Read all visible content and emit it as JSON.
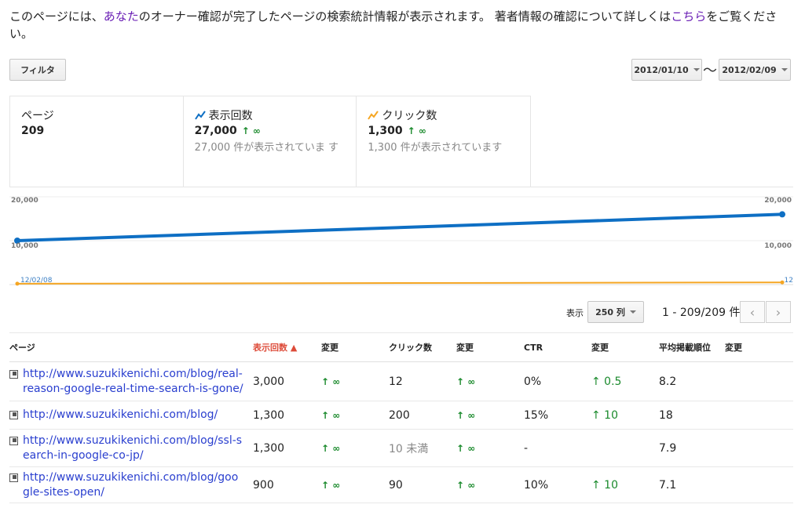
{
  "intro": {
    "text1": "このページには、",
    "link1": "あなた",
    "text2": "のオーナー確認が完了したページの検索統計情報が表示されます。 著者情報の確認について詳しくは",
    "link2": "こちら",
    "text3": "をご覧ください。"
  },
  "filter_label": "フィルタ",
  "date_start": "2012/01/10",
  "date_sep": "〜",
  "date_end": "2012/02/09",
  "summary": [
    {
      "label": "ページ",
      "value": "209",
      "change": "",
      "sub": ""
    },
    {
      "label": "表示回数",
      "value": "27,000",
      "change": "↑ ∞",
      "sub": "27,000 件が表示されていま す"
    },
    {
      "label": "クリック数",
      "value": "1,300",
      "change": "↑ ∞",
      "sub": "1,300 件が表示されています"
    }
  ],
  "colors": {
    "impressions": "#0e6fc4",
    "clicks": "#f5a623",
    "up": "#1a8a2c"
  },
  "graph": {
    "axis_left_top": "20,000",
    "axis_left_mid": "10,000",
    "axis_right_top": "20,000",
    "axis_right_mid": "10,000",
    "date_label": "12/02/08",
    "right_date_label": "12"
  },
  "chart_data": {
    "type": "line",
    "series": [
      {
        "name": "表示回数",
        "values": [
          10000,
          16000
        ]
      },
      {
        "name": "クリック数",
        "values": [
          200,
          500
        ]
      }
    ],
    "ylim": [
      0,
      20000
    ]
  },
  "display_label": "表示",
  "rows_select": "250 列",
  "range_text": "1 - 209/209 件",
  "columns": [
    "ページ",
    "表示回数 ▲",
    "変更",
    "クリック数",
    "変更",
    "CTR",
    "変更",
    "平均掲載順位",
    "変更"
  ],
  "rows": [
    {
      "page": "http://www.suzukikenichi.com/blog/real-reason-google-real-time-search-is-gone/",
      "imp": "3,000",
      "imp_chg": "↑ ∞",
      "clicks": "12",
      "clk_chg": "↑ ∞",
      "ctr": "0%",
      "ctr_chg": "↑ 0.5",
      "pos": "8.2",
      "pos_chg": ""
    },
    {
      "page": "http://www.suzukikenichi.com/blog/",
      "imp": "1,300",
      "imp_chg": "↑ ∞",
      "clicks": "200",
      "clk_chg": "↑ ∞",
      "ctr": "15%",
      "ctr_chg": "↑ 10",
      "pos": "18",
      "pos_chg": ""
    },
    {
      "page": "http://www.suzukikenichi.com/blog/ssl-search-in-google-co-jp/",
      "imp": "1,300",
      "imp_chg": "↑ ∞",
      "clicks": "10 未満",
      "clk_chg": "↑ ∞",
      "ctr": "-",
      "ctr_chg": "",
      "pos": "7.9",
      "pos_chg": ""
    },
    {
      "page": "http://www.suzukikenichi.com/blog/google-sites-open/",
      "imp": "900",
      "imp_chg": "↑ ∞",
      "clicks": "90",
      "clk_chg": "↑ ∞",
      "ctr": "10%",
      "ctr_chg": "↑ 10",
      "pos": "7.1",
      "pos_chg": ""
    }
  ]
}
